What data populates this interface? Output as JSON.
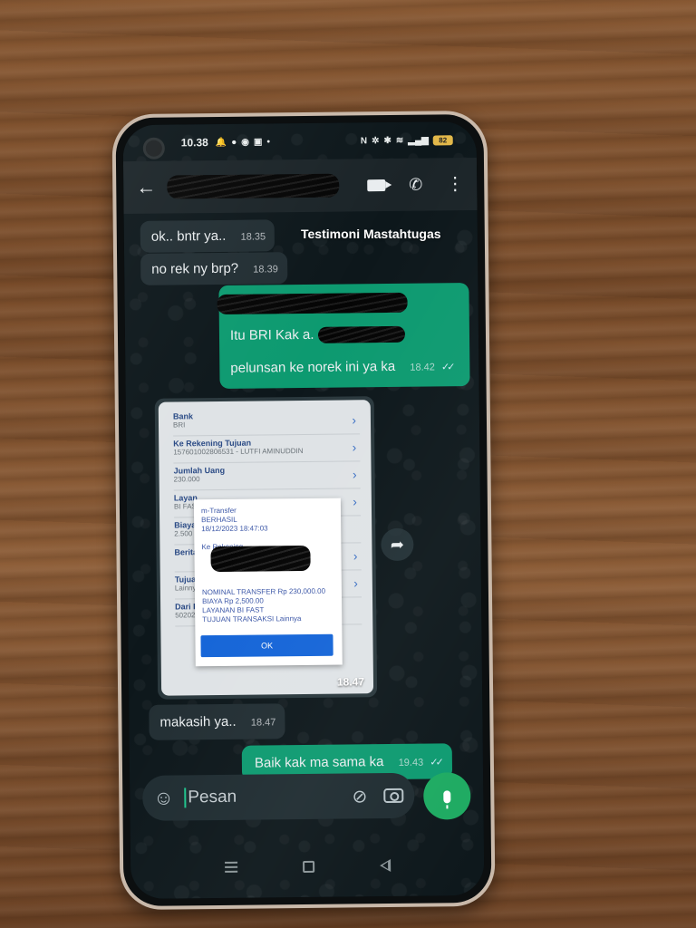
{
  "status_bar": {
    "time": "10.38",
    "battery": "82"
  },
  "header": {
    "back_icon": "arrow-left-icon",
    "contact_name": "",
    "video_call_icon": "video-icon",
    "voice_call_icon": "phone-icon",
    "menu_icon": "more-vert-icon"
  },
  "watermark": "Testimoni Mastahtugas",
  "messages": [
    {
      "direction": "in",
      "text": "ok.. bntr ya..",
      "time": "18.35"
    },
    {
      "direction": "in",
      "text": "no rek ny brp?",
      "time": "18.39"
    },
    {
      "direction": "out",
      "text": "Itu BRI Kak a.",
      "time": ""
    },
    {
      "direction": "out",
      "text": "pelunsan ke norek ini ya ka",
      "time": "18.42",
      "status": "read"
    },
    {
      "direction": "in",
      "type": "image",
      "time": "18.47"
    },
    {
      "direction": "in",
      "text": "makasih ya..",
      "time": "18.47"
    },
    {
      "direction": "out",
      "text": "Baik kak ma sama ka",
      "time": "19.43",
      "status": "read"
    }
  ],
  "image_content": {
    "rows": [
      {
        "label": "Bank",
        "value": "BRI"
      },
      {
        "label": "Ke Rekening Tujuan",
        "value": "157601002806531 - LUTFI AMINUDDIN"
      },
      {
        "label": "Jumlah Uang",
        "value": "230.000"
      },
      {
        "label": "Layan",
        "value": "BI FAS"
      },
      {
        "label": "Biaya",
        "value": "2.500"
      },
      {
        "label": "Berita",
        "value": ""
      },
      {
        "label": "Tujuan",
        "value": "Lainny"
      },
      {
        "label": "Dari R",
        "value": "50202"
      }
    ],
    "popup": {
      "lines_top": [
        "m-Transfer",
        "BERHASIL",
        "18/12/2023 18:47:03",
        "",
        "Ke Rekening"
      ],
      "lines_bottom": [
        "NOMINAL TRANSFER Rp 230,000.00",
        "BIAYA Rp 2,500.00",
        "LAYANAN BI FAST",
        "TUJUAN TRANSAKSI Lainnya"
      ],
      "ok_label": "OK"
    }
  },
  "input": {
    "placeholder": "Pesan",
    "emoji_icon": "emoji-icon",
    "attach_icon": "paperclip-icon",
    "camera_icon": "camera-icon",
    "mic_icon": "mic-icon"
  },
  "colors": {
    "incoming_bubble": "#222e33",
    "outgoing_bubble": "#0d9a70",
    "mic_button": "#1daa61"
  }
}
